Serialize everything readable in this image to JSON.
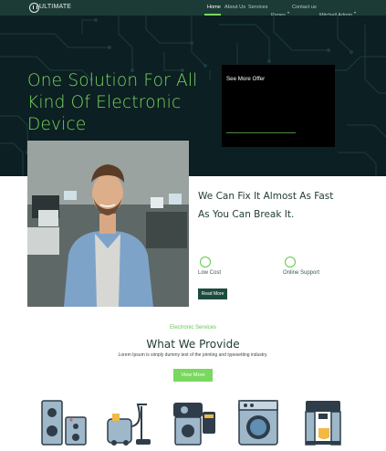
{
  "nav": {
    "logo_text": "ULTIMATE",
    "items": [
      {
        "label": "Home"
      },
      {
        "label": "About Us"
      },
      {
        "label": "Services"
      },
      {
        "label": "Pages"
      },
      {
        "label": "Contact us"
      },
      {
        "label": "Mitchell Admin"
      }
    ]
  },
  "hero": {
    "title": "One Solution For All Kind Of Electronic Device",
    "offer_label": "See More Offer"
  },
  "about": {
    "title": "We Can Fix It Almost As Fast As You Can Break It.",
    "features": [
      {
        "label": "Low Cost",
        "icon": "coins-icon"
      },
      {
        "label": "Online Support",
        "icon": "headset-icon"
      }
    ],
    "read_more": "Read More"
  },
  "services": {
    "kicker": "Electronic Services",
    "title": "What We Provide",
    "description": "Lorem Ipsum is simply dummy text of the printing and typesetting industry.",
    "view_more": "View More",
    "devices": [
      {
        "icon": "speakers-icon"
      },
      {
        "icon": "vacuum-cleaner-icon"
      },
      {
        "icon": "coffee-grinder-icon"
      },
      {
        "icon": "washing-machine-icon"
      },
      {
        "icon": "coffee-machine-icon"
      }
    ]
  },
  "colors": {
    "accent": "#7ad85f",
    "nav_bg": "#1d3b36",
    "hero_bg": "#0c1f22",
    "dark_text": "#1e3a33",
    "button_dark": "#1d4b3f"
  }
}
